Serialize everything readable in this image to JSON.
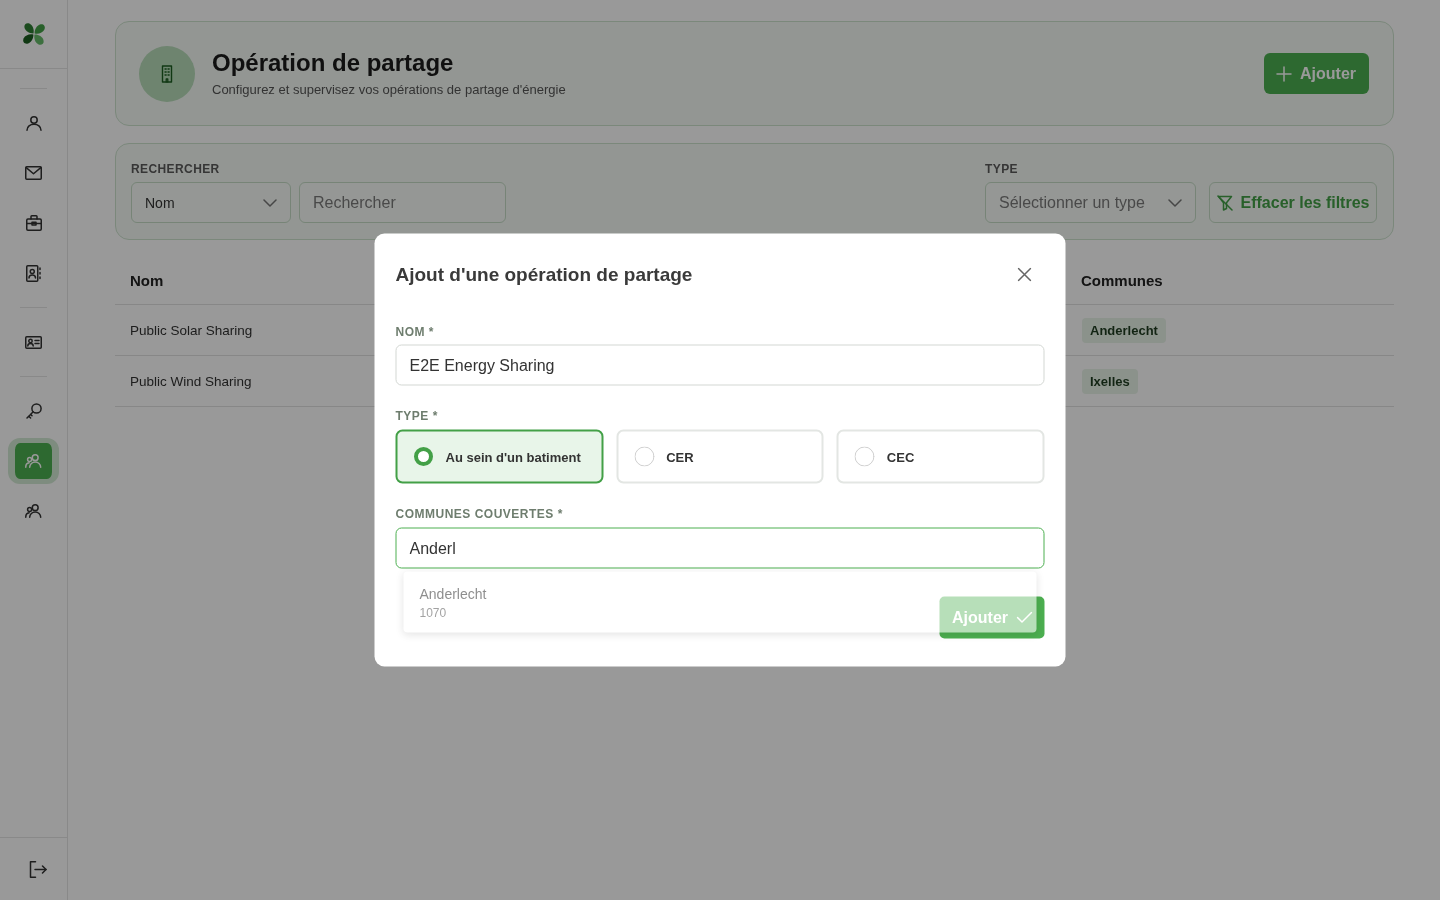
{
  "sidebar": {
    "groups": [
      {
        "items": [
          {
            "selected": false
          },
          {
            "selected": false
          },
          {
            "selected": false
          },
          {
            "selected": false
          }
        ]
      },
      {
        "items": [
          {
            "selected": false
          }
        ]
      },
      {
        "items": [
          {
            "selected": false
          },
          {
            "selected": true
          },
          {
            "selected": false
          }
        ]
      }
    ]
  },
  "header": {
    "title": "Opération de partage",
    "subtitle": "Configurez et supervisez vos opérations de partage d'énergie",
    "add_button": "Ajouter"
  },
  "filters": {
    "search": {
      "label": "RECHERCHER",
      "field": "Nom",
      "placeholder": "Rechercher"
    },
    "type": {
      "label": "TYPE",
      "placeholder": "Sélectionner un type"
    },
    "clear_button": "Effacer les filtres"
  },
  "table": {
    "columns": [
      {
        "label": "Nom"
      },
      {
        "label": "Communes"
      }
    ],
    "rows": [
      {
        "name": "Public Solar Sharing",
        "communes": [
          "Anderlecht"
        ]
      },
      {
        "name": "Public Wind Sharing",
        "communes": [
          "Ixelles"
        ]
      }
    ]
  },
  "modal": {
    "title": "Ajout d'une opération de partage",
    "name_field": {
      "label": "NOM *",
      "value": "E2E Energy Sharing"
    },
    "type_field": {
      "label": "TYPE *",
      "options": [
        {
          "label": "Au sein d'un batiment",
          "selected": true
        },
        {
          "label": "CER",
          "selected": false
        },
        {
          "label": "CEC",
          "selected": false
        }
      ]
    },
    "communes_field": {
      "label": "COMMUNES COUVERTES *",
      "value": "Anderl",
      "focused": true,
      "suggestions": [
        {
          "name": "Anderlecht",
          "postcode": "1070"
        }
      ]
    },
    "submit_button": "Ajouter"
  }
}
